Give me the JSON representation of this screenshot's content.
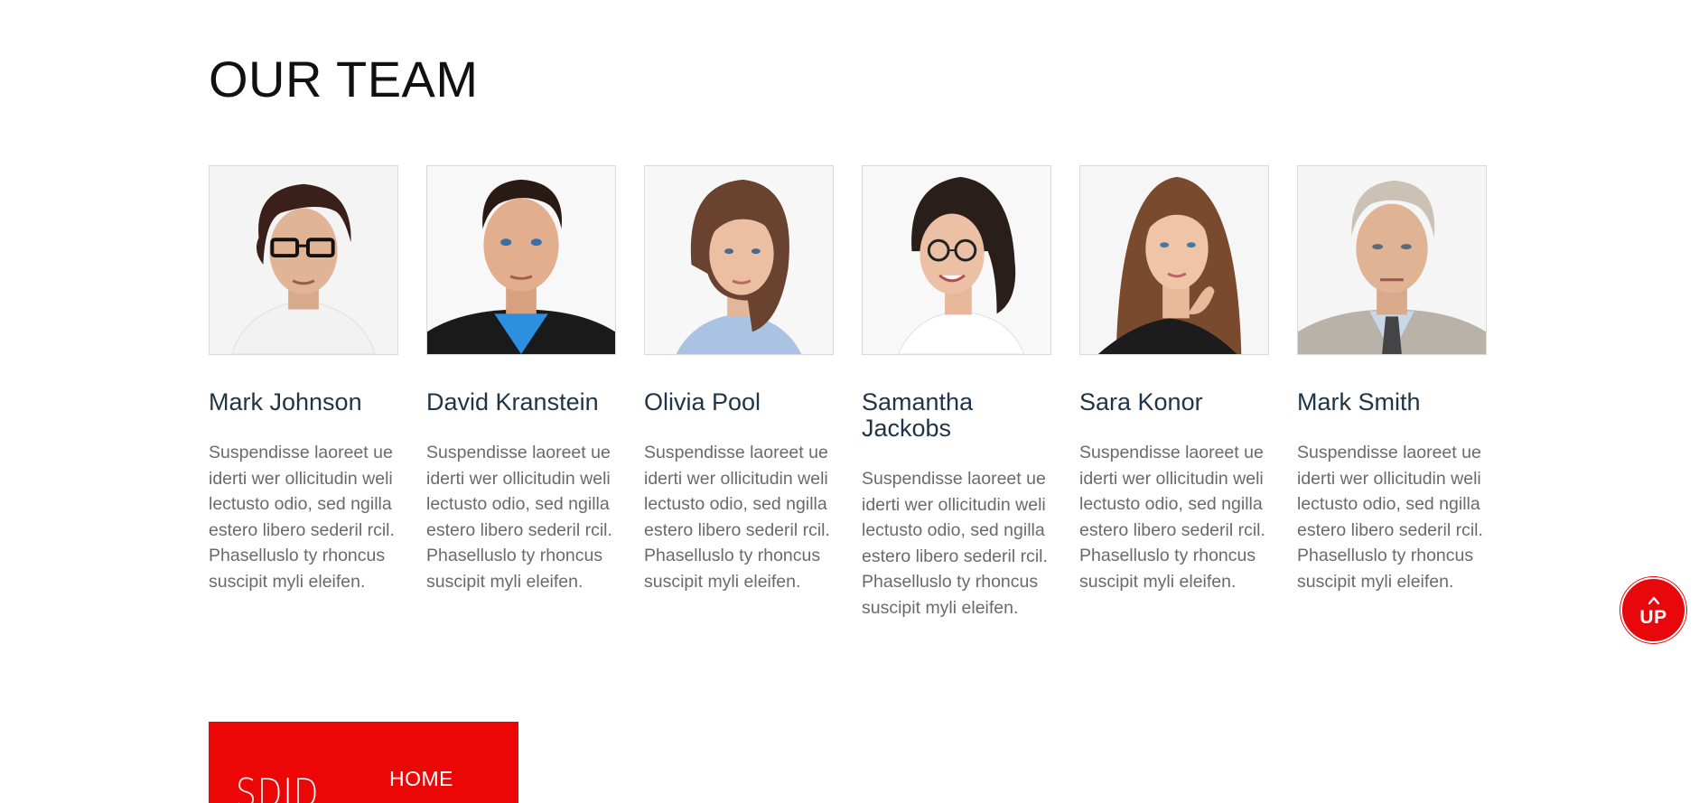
{
  "section": {
    "title": "OUR TEAM"
  },
  "team": [
    {
      "name": "Mark Johnson",
      "bio": "Suspendisse laoreet ue iderti wer ollicitudin weli lectusto odio, sed ngilla estero libero sederil rcil. Phasellusl​o ty rhoncus suscipit myli eleifen.",
      "photo_icon": "portrait-man-glasses"
    },
    {
      "name": "David Kranstein",
      "bio": "Suspendisse laoreet ue iderti wer ollicitudin weli lectusto odio, sed ngilla estero libero sederil rcil. Phasellusl​o ty rhoncus suscipit myli eleifen.",
      "photo_icon": "portrait-man-suit"
    },
    {
      "name": "Olivia Pool",
      "bio": "Suspendisse laoreet ue iderti wer ollicitudin weli lectusto odio, sed ngilla estero libero sederil rcil. Phasellusl​o ty rhoncus suscipit myli eleifen.",
      "photo_icon": "portrait-woman"
    },
    {
      "name": "Samantha Jackobs",
      "bio": "Suspendisse laoreet ue iderti wer ollicitudin weli lectusto odio, sed ngilla estero libero sederil rcil. Phasellusl​o ty rhoncus suscipit myli eleifen.",
      "photo_icon": "portrait-woman-glasses"
    },
    {
      "name": "Sara Konor",
      "bio": "Suspendisse laoreet ue iderti wer ollicitudin weli lectusto odio, sed ngilla estero libero sederil rcil. Phasellusl​o ty rhoncus suscipit myli eleifen.",
      "photo_icon": "portrait-woman-long-hair"
    },
    {
      "name": "Mark Smith",
      "bio": "Suspendisse laoreet ue iderti wer ollicitudin weli lectusto odio, sed ngilla estero libero sederil rcil. Phasellusl​o ty rhoncus suscipit myli eleifen.",
      "photo_icon": "portrait-older-man"
    }
  ],
  "up_button": {
    "label": "UP",
    "icon": "chevron-up-icon"
  },
  "footer": {
    "logo_text": "SDID",
    "nav_home": "HOME"
  },
  "colors": {
    "accent": "#ec0606",
    "name_text": "#1f3447",
    "bio_text": "#6a6a6a"
  }
}
